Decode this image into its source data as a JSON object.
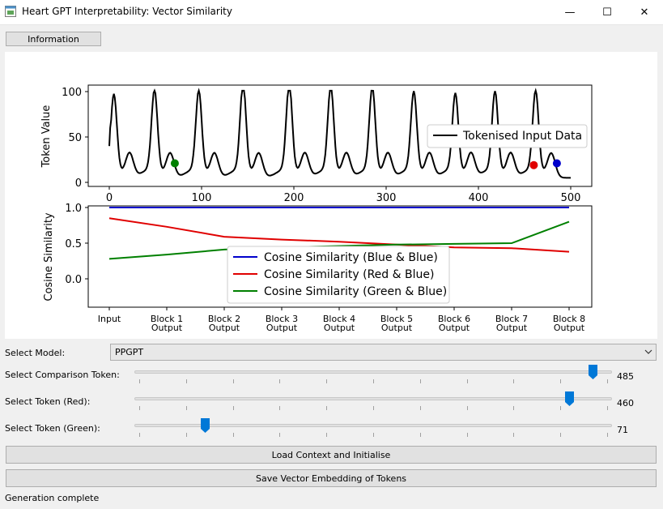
{
  "window": {
    "title": "Heart GPT Interpretability: Vector Similarity",
    "minimize_glyph": "—",
    "maximize_glyph": "☐",
    "close_glyph": "✕"
  },
  "info_button": "Information",
  "plots": {
    "top": {
      "ylabel": "Token Value",
      "x_ticks": [
        "0",
        "100",
        "200",
        "300",
        "400",
        "500"
      ],
      "y_ticks": [
        "0",
        "50",
        "100"
      ],
      "legend": "Tokenised Input Data",
      "markers": [
        {
          "color": "#008000",
          "token": 71,
          "value": 21
        },
        {
          "color": "#e00000",
          "token": 460,
          "value": 19
        },
        {
          "color": "#0000cc",
          "token": 485,
          "value": 21
        }
      ]
    },
    "bottom": {
      "ylabel": "Cosine Similarity",
      "y_ticks": [
        "0.0",
        "0.5",
        "1.0"
      ],
      "x_ticks": [
        [
          "Input"
        ],
        [
          "Block 1",
          "Output"
        ],
        [
          "Block 2",
          "Output"
        ],
        [
          "Block 3",
          "Output"
        ],
        [
          "Block 4",
          "Output"
        ],
        [
          "Block 5",
          "Output"
        ],
        [
          "Block 6",
          "Output"
        ],
        [
          "Block 7",
          "Output"
        ],
        [
          "Block 8",
          "Output"
        ]
      ],
      "legend": [
        "Cosine Similarity (Blue & Blue)",
        "Cosine Similarity (Red & Blue)",
        "Cosine Similarity (Green & Blue)"
      ]
    }
  },
  "chart_data": [
    {
      "type": "line",
      "xlim": [
        0,
        500
      ],
      "ylim": [
        0,
        110
      ],
      "ylabel": "Token Value",
      "series": [
        {
          "name": "Tokenised Input Data",
          "color": "#000000"
        }
      ],
      "highlighted_points": [
        {
          "x": 71,
          "y": 21,
          "color": "green"
        },
        {
          "x": 460,
          "y": 19,
          "color": "red"
        },
        {
          "x": 485,
          "y": 21,
          "color": "blue"
        }
      ]
    },
    {
      "type": "line",
      "categories": [
        "Input",
        "Block 1 Output",
        "Block 2 Output",
        "Block 3 Output",
        "Block 4 Output",
        "Block 5 Output",
        "Block 6 Output",
        "Block 7 Output",
        "Block 8 Output"
      ],
      "ylim": [
        -0.4,
        1.0
      ],
      "ylabel": "Cosine Similarity",
      "series": [
        {
          "name": "Cosine Similarity (Blue & Blue)",
          "color": "#0000cc",
          "values": [
            1.0,
            1.0,
            1.0,
            1.0,
            1.0,
            1.0,
            1.0,
            1.0,
            1.0
          ]
        },
        {
          "name": "Cosine Similarity (Red & Blue)",
          "color": "#e00000",
          "values": [
            0.85,
            0.73,
            0.59,
            0.55,
            0.52,
            0.48,
            0.44,
            0.43,
            0.38
          ]
        },
        {
          "name": "Cosine Similarity (Green & Blue)",
          "color": "#008000",
          "values": [
            0.28,
            0.34,
            0.41,
            0.44,
            0.46,
            0.48,
            0.49,
            0.5,
            0.8
          ]
        }
      ]
    }
  ],
  "controls": {
    "model_label": "Select Model:",
    "model_value": "PPGPT",
    "comparison_label": "Select Comparison Token:",
    "comparison_value": "485",
    "red_label": "Select Token (Red):",
    "red_value": "460",
    "green_label": "Select Token (Green):",
    "green_value": "71",
    "slider_max": 500,
    "load_button": "Load Context and Initialise",
    "save_button": "Save Vector Embedding of Tokens"
  },
  "status": "Generation complete",
  "colors": {
    "accent": "#0078d7"
  }
}
